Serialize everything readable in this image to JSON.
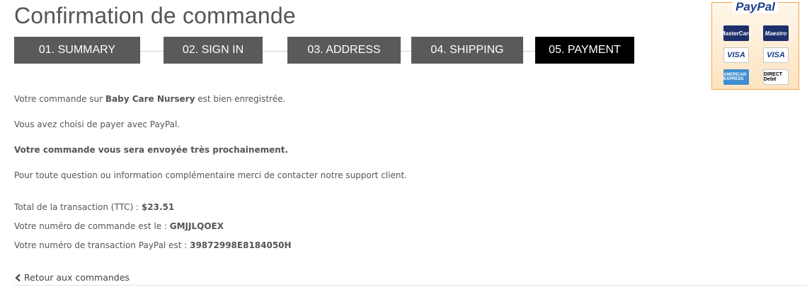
{
  "page": {
    "title": "Confirmation de commande"
  },
  "steps": [
    {
      "label": "01. SUMMARY",
      "active": false
    },
    {
      "label": "02. SIGN IN",
      "active": false
    },
    {
      "label": "03. ADDRESS",
      "active": false
    },
    {
      "label": "04. SHIPPING",
      "active": false
    },
    {
      "label": "05. PAYMENT",
      "active": true
    }
  ],
  "message": {
    "line1_prefix": "Votre commande sur ",
    "shop_name": "Baby Care Nursery",
    "line1_suffix": " est bien enregistrée.",
    "line2": "Vous avez choisi de payer avec PayPal.",
    "line3": "Votre commande vous sera envoyée très prochainement.",
    "line4": "Pour toute question ou information complémentaire merci de contacter notre support client."
  },
  "details": {
    "total_label": "Total de la transaction (TTC) : ",
    "total_value": "$23.51",
    "order_label": "Votre numéro de commande est le : ",
    "order_value": "GMJJLQOEX",
    "transaction_label": "Votre numéro de transaction PayPal est : ",
    "transaction_value": "39872998E8184050H"
  },
  "back_link": {
    "label": "Retour aux commandes",
    "icon": "chevron-left-icon"
  },
  "paypal_badge": {
    "logo": "PayPal",
    "cards": [
      "MasterCard",
      "Maestro",
      "VISA",
      "VISA",
      "AMERICAN EXPRESS",
      "DIRECT Debit"
    ]
  }
}
